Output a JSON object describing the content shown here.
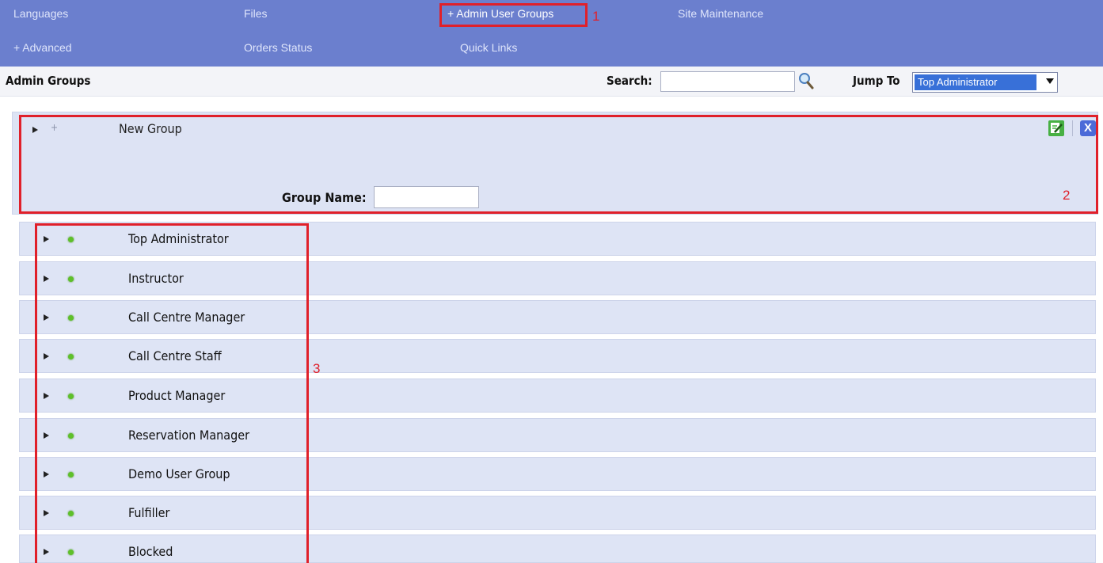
{
  "nav": {
    "row1": [
      "Languages",
      "Files",
      "+ Admin User Groups",
      "Site Maintenance"
    ],
    "row2": [
      "+ Advanced",
      "Orders Status",
      "Quick Links"
    ]
  },
  "annotations": [
    "1",
    "2",
    "3"
  ],
  "header": {
    "title": "Admin Groups",
    "search_label": "Search:",
    "search_value": "",
    "jump_label": "Jump To",
    "jump_selected": "Top Administrator"
  },
  "new_group": {
    "title": "New Group",
    "plus": "+",
    "group_name_label": "Group Name:",
    "group_name_value": "",
    "close_glyph": "X"
  },
  "groups": [
    "Top Administrator",
    "Instructor",
    "Call Centre Manager",
    "Call Centre Staff",
    "Product Manager",
    "Reservation Manager",
    "Demo User Group",
    "Fulfiller",
    "Blocked"
  ],
  "colors": {
    "nav_bg": "#6b7fce",
    "highlight": "#e0202a",
    "row_bg": "#dee4f5"
  }
}
